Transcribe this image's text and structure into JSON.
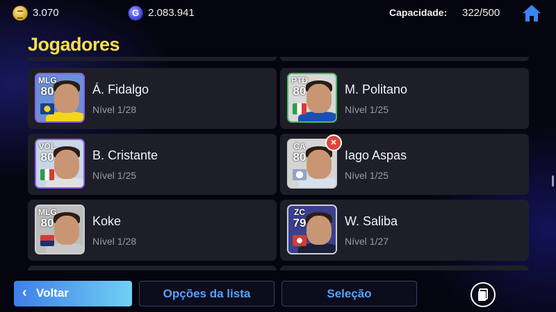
{
  "topbar": {
    "gp_amount": "3.070",
    "coin_amount": "2.083.941",
    "coin_symbol": "G",
    "capacity_label": "Capacidade:",
    "capacity_value": "322/500"
  },
  "page_title": "Jogadores",
  "players": [
    {
      "position": "MLG",
      "rating": "80",
      "name": "Á. Fidalgo",
      "level": "Nível 1/28",
      "shirt_color": "#f4d51a",
      "bg": "#6b8fd6",
      "border": "#8a5ef0"
    },
    {
      "position": "PTD",
      "rating": "80",
      "name": "M. Politano",
      "level": "Nível 1/25",
      "shirt_color": "#1b4fb3",
      "bg": "#d9d9d9",
      "border": "#3cc05a"
    },
    {
      "position": "VOL",
      "rating": "80",
      "name": "B. Cristante",
      "level": "Nível 1/25",
      "shirt_color": "#e0e0e0",
      "bg": "#c9d6e8",
      "border": "#8a5ef0"
    },
    {
      "position": "CA",
      "rating": "80",
      "name": "Iago Aspas",
      "level": "Nível 1/25",
      "shirt_color": "#d7e0ec",
      "bg": "#d4d4d4",
      "border": "#cfcfcf"
    },
    {
      "position": "MLG",
      "rating": "80",
      "name": "Koke",
      "level": "Nível 1/28",
      "shirt_color": "#c8c8c8",
      "bg": "#bcbcbc",
      "border": "#cfcfcf"
    },
    {
      "position": "ZC",
      "rating": "79",
      "name": "W. Saliba",
      "level": "Nível 1/27",
      "shirt_color": "#1a1f3a",
      "bg": "#3a3f8f",
      "border": "#cfcfcf"
    }
  ],
  "remove_icon": "×",
  "buttons": {
    "back": "Voltar",
    "back_icon": "‹",
    "list_options": "Opções da lista",
    "selection": "Seleção"
  },
  "colors": {
    "title": "#f6e04a",
    "accent_blue": "#55a3ff"
  }
}
